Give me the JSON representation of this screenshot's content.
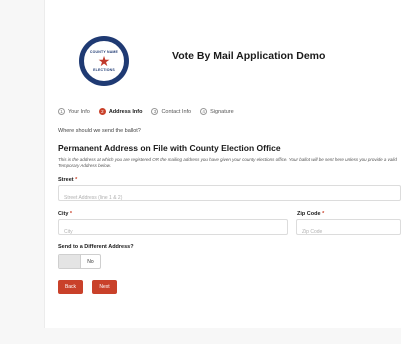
{
  "header": {
    "logo_text_top": "COUNTY NAME",
    "logo_text_bottom": "ELECTIONS",
    "title": "Vote By Mail Application Demo"
  },
  "steps": [
    {
      "num": "1",
      "label": "Your Info",
      "active": false
    },
    {
      "num": "2",
      "label": "Address Info",
      "active": true
    },
    {
      "num": "3",
      "label": "Contact Info",
      "active": false
    },
    {
      "num": "4",
      "label": "Signature",
      "active": false
    }
  ],
  "form": {
    "prompt": "Where should we send the ballot?",
    "section_title": "Permanent Address on File with County Election Office",
    "section_description": "This is the address at which you are registered OR the mailing address you have given your county elections office. Your ballot will be sent here unless you provide a valid Temporary Address below.",
    "street": {
      "label": "Street",
      "required_mark": "*",
      "placeholder": "Street Address (line 1 & 2)",
      "value": ""
    },
    "city": {
      "label": "City",
      "required_mark": "*",
      "placeholder": "City",
      "value": ""
    },
    "zip": {
      "label": "Zip Code",
      "required_mark": "*",
      "placeholder": "Zip Code",
      "value": ""
    },
    "different_address": {
      "label": "Send to a Different Address?",
      "toggle_value": "No"
    },
    "back_label": "Back",
    "next_label": "Next"
  },
  "colors": {
    "accent": "#c9412a",
    "logo_blue": "#1f3a73"
  }
}
